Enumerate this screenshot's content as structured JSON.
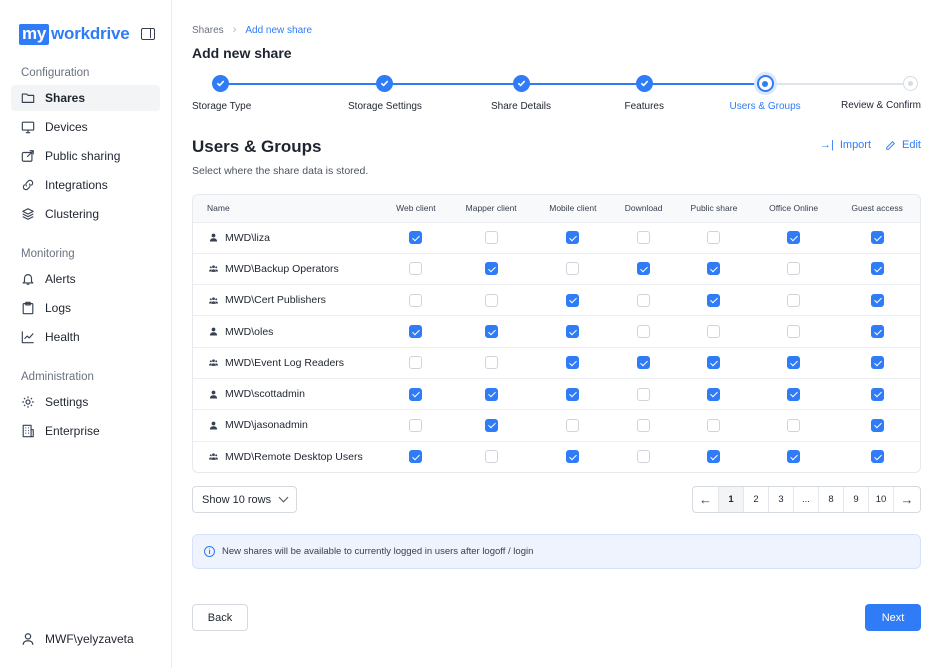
{
  "brand": {
    "logo_box": "my",
    "logo_text": "workdrive"
  },
  "sidebar": {
    "sections": [
      {
        "label": "Configuration",
        "items": [
          {
            "label": "Shares",
            "icon": "folder-icon",
            "active": true
          },
          {
            "label": "Devices",
            "icon": "monitor-icon"
          },
          {
            "label": "Public sharing",
            "icon": "share-icon"
          },
          {
            "label": "Integrations",
            "icon": "link-icon"
          },
          {
            "label": "Clustering",
            "icon": "layers-icon"
          }
        ]
      },
      {
        "label": "Monitoring",
        "items": [
          {
            "label": "Alerts",
            "icon": "bell-icon"
          },
          {
            "label": "Logs",
            "icon": "clipboard-icon"
          },
          {
            "label": "Health",
            "icon": "chart-icon"
          }
        ]
      },
      {
        "label": "Administration",
        "items": [
          {
            "label": "Settings",
            "icon": "gear-icon"
          },
          {
            "label": "Enterprise",
            "icon": "building-icon"
          }
        ]
      }
    ],
    "user": "MWF\\yelyzaveta"
  },
  "breadcrumb": {
    "parent": "Shares",
    "current": "Add new share"
  },
  "page_title": "Add new share",
  "steps": [
    {
      "label": "Storage Type",
      "state": "done"
    },
    {
      "label": "Storage Settings",
      "state": "done"
    },
    {
      "label": "Share Details",
      "state": "done"
    },
    {
      "label": "Features",
      "state": "done"
    },
    {
      "label": "Users & Groups",
      "state": "current"
    },
    {
      "label": "Review & Confirm",
      "state": "todo"
    }
  ],
  "section": {
    "title": "Users & Groups",
    "subtitle": "Select where the share data is stored.",
    "import_label": "Import",
    "edit_label": "Edit"
  },
  "table": {
    "columns": [
      "Name",
      "Web client",
      "Mapper client",
      "Mobile client",
      "Download",
      "Public share",
      "Office Online",
      "Guest access"
    ],
    "rows": [
      {
        "name": "MWD\\liza",
        "type": "user",
        "checks": [
          true,
          false,
          true,
          false,
          false,
          true,
          true
        ]
      },
      {
        "name": "MWD\\Backup Operators",
        "type": "group",
        "checks": [
          false,
          true,
          false,
          true,
          true,
          false,
          true
        ]
      },
      {
        "name": "MWD\\Cert Publishers",
        "type": "group",
        "checks": [
          false,
          false,
          true,
          false,
          true,
          false,
          true
        ]
      },
      {
        "name": "MWD\\oles",
        "type": "user",
        "checks": [
          true,
          true,
          true,
          false,
          false,
          false,
          true
        ]
      },
      {
        "name": "MWD\\Event Log Readers",
        "type": "group",
        "checks": [
          false,
          false,
          true,
          true,
          true,
          true,
          true
        ]
      },
      {
        "name": "MWD\\scottadmin",
        "type": "user",
        "checks": [
          true,
          true,
          true,
          false,
          true,
          true,
          true
        ]
      },
      {
        "name": "MWD\\jasonadmin",
        "type": "user",
        "checks": [
          false,
          true,
          false,
          false,
          false,
          false,
          true
        ]
      },
      {
        "name": "MWD\\Remote Desktop Users",
        "type": "group",
        "checks": [
          true,
          false,
          true,
          false,
          true,
          true,
          true
        ]
      }
    ]
  },
  "pagination": {
    "rows_label": "Show 10 rows",
    "pages": [
      "1",
      "2",
      "3",
      "...",
      "8",
      "9",
      "10"
    ],
    "active": "1"
  },
  "info": "New shares will be available to currently logged in users after logoff / login",
  "buttons": {
    "back": "Back",
    "next": "Next"
  },
  "colors": {
    "accent": "#2f7cf6"
  }
}
